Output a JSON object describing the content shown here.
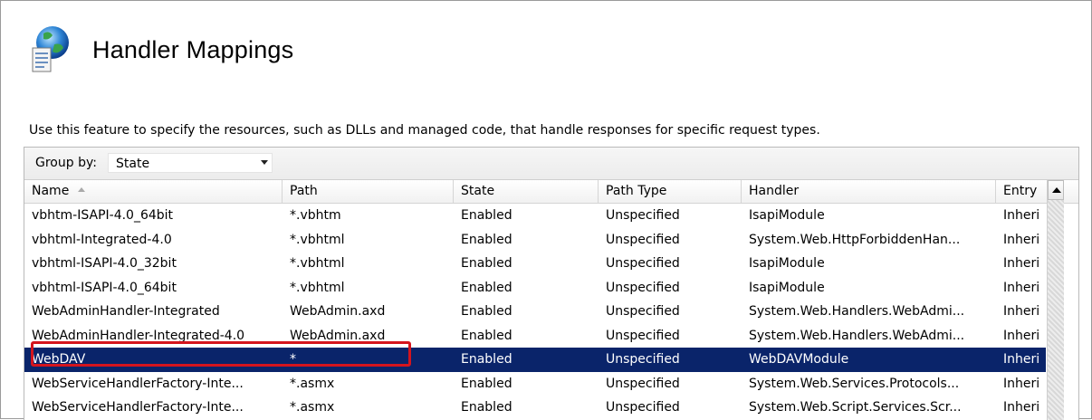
{
  "header": {
    "title": "Handler Mappings"
  },
  "description": "Use this feature to specify the resources, such as DLLs and managed code, that handle responses for specific request types.",
  "groupby": {
    "label": "Group by:",
    "value": "State"
  },
  "columns": [
    "Name",
    "Path",
    "State",
    "Path Type",
    "Handler",
    "Entry"
  ],
  "rows": [
    [
      "vbhtm-ISAPI-4.0_64bit",
      "*.vbhtm",
      "Enabled",
      "Unspecified",
      "IsapiModule",
      "Inheri"
    ],
    [
      "vbhtml-Integrated-4.0",
      "*.vbhtml",
      "Enabled",
      "Unspecified",
      "System.Web.HttpForbiddenHan...",
      "Inheri"
    ],
    [
      "vbhtml-ISAPI-4.0_32bit",
      "*.vbhtml",
      "Enabled",
      "Unspecified",
      "IsapiModule",
      "Inheri"
    ],
    [
      "vbhtml-ISAPI-4.0_64bit",
      "*.vbhtml",
      "Enabled",
      "Unspecified",
      "IsapiModule",
      "Inheri"
    ],
    [
      "WebAdminHandler-Integrated",
      "WebAdmin.axd",
      "Enabled",
      "Unspecified",
      "System.Web.Handlers.WebAdmi...",
      "Inheri"
    ],
    [
      "WebAdminHandler-Integrated-4.0",
      "WebAdmin.axd",
      "Enabled",
      "Unspecified",
      "System.Web.Handlers.WebAdmi...",
      "Inheri"
    ],
    [
      "WebDAV",
      "*",
      "Enabled",
      "Unspecified",
      "WebDAVModule",
      "Inheri"
    ],
    [
      "WebServiceHandlerFactory-Inte...",
      "*.asmx",
      "Enabled",
      "Unspecified",
      "System.Web.Services.Protocols...",
      "Inheri"
    ],
    [
      "WebServiceHandlerFactory-Inte...",
      "*.asmx",
      "Enabled",
      "Unspecified",
      "System.Web.Script.Services.Scr...",
      "Inheri"
    ]
  ],
  "colors": {
    "selection": "#0a246a",
    "highlight_border": "#d4141d"
  }
}
